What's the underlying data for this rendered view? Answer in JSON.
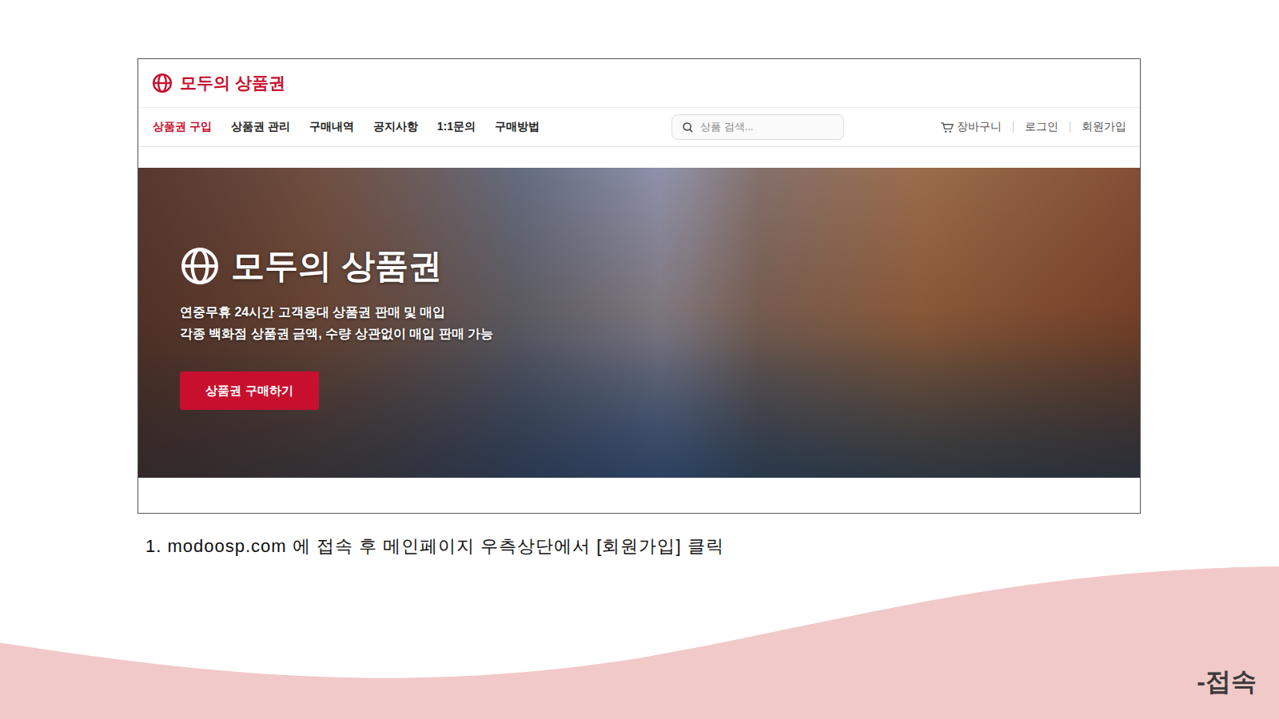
{
  "site": {
    "logo": "모두의 상품권",
    "nav": [
      {
        "label": "상품권 구입",
        "selected": true
      },
      {
        "label": "상품권 관리",
        "selected": false
      },
      {
        "label": "구매내역",
        "selected": false
      },
      {
        "label": "공지사항",
        "selected": false
      },
      {
        "label": "1:1문의",
        "selected": false
      },
      {
        "label": "구매방법",
        "selected": false
      }
    ],
    "search": {
      "placeholder": "상품 검색..."
    },
    "user_links": [
      "장바구니",
      "로그인",
      "회원가입"
    ],
    "hero": {
      "title": "모두의 상품권",
      "lines": [
        "연중무휴 24시간 고객응대 상품권 판매 및 매입",
        "각종 백화점 상품권 금액, 수량 상관없이 매입 판매 가능"
      ],
      "button": "상품권 구매하기"
    }
  },
  "slide": {
    "caption": "1. modoosp.com 에 접속 후 메인페이지 우측상단에서 [회원가입] 클릭",
    "section_label": "-접속"
  }
}
